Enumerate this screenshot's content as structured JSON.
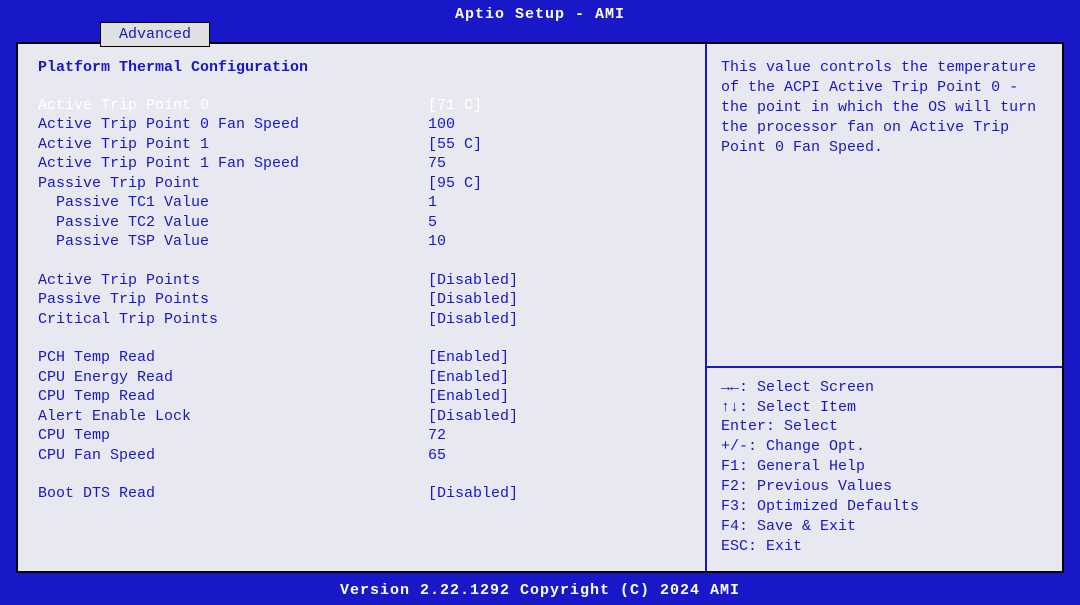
{
  "title": "Aptio Setup - AMI",
  "active_tab": "Advanced",
  "page_heading": "Platform Thermal Configuration",
  "settings": [
    {
      "label": "Active Trip Point 0",
      "value": "[71 C]",
      "selected": true,
      "indent": false
    },
    {
      "label": "Active Trip Point 0 Fan Speed",
      "value": "100",
      "selected": false,
      "indent": false
    },
    {
      "label": "Active Trip Point 1",
      "value": "[55 C]",
      "selected": false,
      "indent": false
    },
    {
      "label": "Active Trip Point 1 Fan Speed",
      "value": "75",
      "selected": false,
      "indent": false
    },
    {
      "label": "Passive Trip Point",
      "value": "[95 C]",
      "selected": false,
      "indent": false
    },
    {
      "label": "Passive TC1 Value",
      "value": "1",
      "selected": false,
      "indent": true
    },
    {
      "label": "Passive TC2 Value",
      "value": "5",
      "selected": false,
      "indent": true
    },
    {
      "label": "Passive TSP Value",
      "value": "10",
      "selected": false,
      "indent": true
    },
    {
      "spacer": true
    },
    {
      "label": "Active Trip Points",
      "value": "[Disabled]",
      "selected": false,
      "indent": false
    },
    {
      "label": "Passive Trip Points",
      "value": "[Disabled]",
      "selected": false,
      "indent": false
    },
    {
      "label": "Critical Trip Points",
      "value": "[Disabled]",
      "selected": false,
      "indent": false
    },
    {
      "spacer": true
    },
    {
      "label": "PCH Temp Read",
      "value": "[Enabled]",
      "selected": false,
      "indent": false
    },
    {
      "label": "CPU Energy Read",
      "value": "[Enabled]",
      "selected": false,
      "indent": false
    },
    {
      "label": "CPU Temp Read",
      "value": "[Enabled]",
      "selected": false,
      "indent": false
    },
    {
      "label": "Alert Enable Lock",
      "value": "[Disabled]",
      "selected": false,
      "indent": false
    },
    {
      "label": "CPU Temp",
      "value": "72",
      "selected": false,
      "indent": false
    },
    {
      "label": "CPU Fan Speed",
      "value": "65",
      "selected": false,
      "indent": false
    },
    {
      "spacer": true
    },
    {
      "label": "Boot DTS Read",
      "value": "[Disabled]",
      "selected": false,
      "indent": false
    }
  ],
  "help_text": "This value controls the temperature of the ACPI Active Trip Point 0 - the point in which the OS will turn the processor fan on Active Trip Point 0 Fan Speed.",
  "legend": [
    "→←: Select Screen",
    "↑↓: Select Item",
    "Enter: Select",
    "+/-: Change Opt.",
    "F1: General Help",
    "F2: Previous Values",
    "F3: Optimized Defaults",
    "F4: Save & Exit",
    "ESC: Exit"
  ],
  "footer": "Version 2.22.1292 Copyright (C) 2024 AMI"
}
